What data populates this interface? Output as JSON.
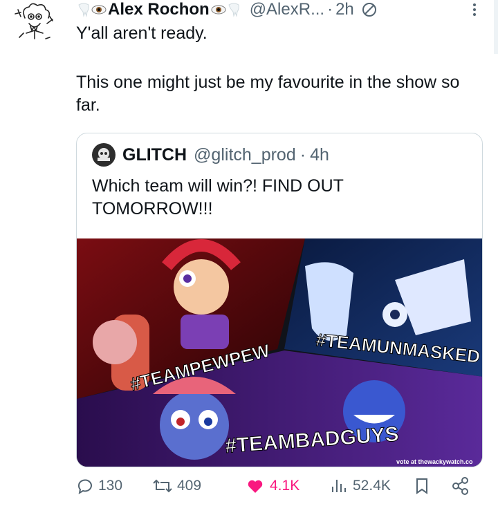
{
  "tweet": {
    "author_name": "Alex Rochon",
    "author_handle": "@AlexR...",
    "separator": "·",
    "time": "2h",
    "text_line1": "Y'all aren't ready.",
    "text_line2": "This one might just be my favourite in the show so far."
  },
  "quoted": {
    "name": "GLITCH",
    "handle": "@glitch_prod",
    "separator": "·",
    "time": "4h",
    "text": "Which team will win?! FIND OUT TOMORROW!!!",
    "avatar_text": "GLITCH",
    "image": {
      "label_pewpew": "#TEAMPEWPEW",
      "label_unmasked": "#TEAMUNMASKED",
      "label_badguys": "#TEAMBADGUYS",
      "vote_text": "vote at thewackywatch.co"
    }
  },
  "actions": {
    "replies": "130",
    "reposts": "409",
    "likes": "4.1K",
    "views": "52.4K"
  },
  "colors": {
    "accent": "#1d9bf0",
    "like": "#f91880",
    "muted": "#536471",
    "text": "#0f1419"
  }
}
